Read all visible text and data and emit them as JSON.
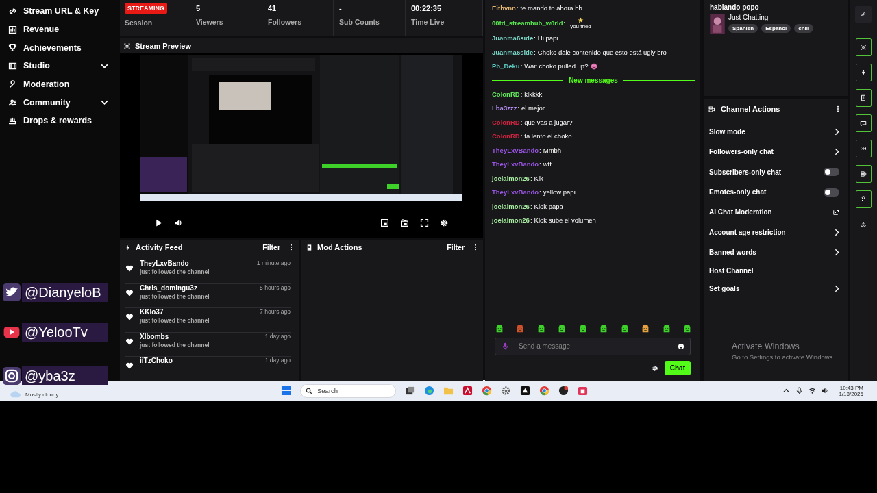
{
  "sidebar": {
    "items": [
      {
        "label": "Stream URL & Key",
        "has_submenu": false
      },
      {
        "label": "Revenue",
        "has_submenu": false
      },
      {
        "label": "Achievements",
        "has_submenu": false
      },
      {
        "label": "Studio",
        "has_submenu": true
      },
      {
        "label": "Moderation",
        "has_submenu": false
      },
      {
        "label": "Community",
        "has_submenu": true
      },
      {
        "label": "Drops & rewards",
        "has_submenu": false
      }
    ]
  },
  "session": {
    "badge": "STREAMING",
    "label": "Session"
  },
  "stats": [
    {
      "value": "5",
      "label": "Viewers"
    },
    {
      "value": "41",
      "label": "Followers"
    },
    {
      "value": "-",
      "label": "Sub Counts"
    },
    {
      "value": "00:22:35",
      "label": "Time Live"
    }
  ],
  "preview": {
    "title": "Stream Preview"
  },
  "activity_feed": {
    "title": "Activity Feed",
    "filter": "Filter",
    "items": [
      {
        "user": "TheyLxvBando",
        "action": "just followed the channel",
        "time": "1 minute ago"
      },
      {
        "user": "Chris_domingu3z",
        "action": "just followed the channel",
        "time": "5 hours ago"
      },
      {
        "user": "KKlo37",
        "action": "just followed the channel",
        "time": "7 hours ago"
      },
      {
        "user": "Xlbombs",
        "action": "just followed the channel",
        "time": "1 day ago"
      },
      {
        "user": "iiTzChoko",
        "time": "1 day ago"
      }
    ]
  },
  "mod_actions": {
    "title": "Mod Actions",
    "filter": "Filter"
  },
  "chat": {
    "name_separator": ":",
    "messages": [
      {
        "kind": "message",
        "user": "Eithvnn",
        "color": "#e8b872",
        "text": "te mando to ahora bb"
      },
      {
        "kind": "message",
        "user": "00fd_streamhub_w0rld",
        "color": "#59e34f",
        "emote_caption": "you tried"
      },
      {
        "kind": "message",
        "user": "Juanma6side",
        "color": "#7ad8c8",
        "text": "Hi papi"
      },
      {
        "kind": "message",
        "user": "Juanma6side",
        "color": "#7ad8c8",
        "text": "Choko dale contenido que esto está ugly bro"
      },
      {
        "kind": "message",
        "user": "Pb_Deku",
        "color": "#5ccac0",
        "text": "Wait choko pulled up?",
        "emoji": true
      },
      {
        "kind": "divider",
        "text": "New messages"
      },
      {
        "kind": "message",
        "user": "ColonRD",
        "color": "#62e85a",
        "text": "klkkkk"
      },
      {
        "kind": "message",
        "user": "Lba3zzz",
        "color": "#b58cf2",
        "text": "el mejor"
      },
      {
        "kind": "message",
        "user": "ColonRD",
        "color": "#d0243e",
        "text": "que vas a jugar?"
      },
      {
        "kind": "message",
        "user": "ColonRD",
        "color": "#d0243e",
        "text": "ta lento el choko"
      },
      {
        "kind": "message",
        "user": "TheyLxvBando",
        "color": "#9a55e6",
        "text": "Mmbh"
      },
      {
        "kind": "message",
        "user": "TheyLxvBando",
        "color": "#9a55e6",
        "text": "wtf"
      },
      {
        "kind": "message",
        "user": "joelalmon26",
        "color": "#a9f0a2",
        "text": "Klk"
      },
      {
        "kind": "message",
        "user": "TheyLxvBando",
        "color": "#9a55e6",
        "text": "yellow papi"
      },
      {
        "kind": "message",
        "user": "joelalmon26",
        "color": "#a9f0a2",
        "text": "Klok papa"
      },
      {
        "kind": "message",
        "user": "joelalmon26",
        "color": "#a9f0a2",
        "text": "Klok sube el volumen"
      }
    ],
    "input": {
      "placeholder": "Send a message"
    },
    "send_button": "Chat"
  },
  "stream_info": {
    "title": "hablando popo",
    "category": "Just Chatting",
    "tags": [
      "Spanish",
      "Español",
      "chill"
    ]
  },
  "channel_actions": {
    "title": "Channel Actions",
    "items": [
      {
        "label": "Slow mode",
        "kind": "submenu"
      },
      {
        "label": "Followers-only chat",
        "kind": "submenu"
      },
      {
        "label": "Subscribers-only chat",
        "kind": "toggle",
        "on": false
      },
      {
        "label": "Emotes-only chat",
        "kind": "toggle",
        "on": false
      },
      {
        "label": "AI Chat Moderation",
        "kind": "external"
      },
      {
        "label": "Account age restriction",
        "kind": "submenu"
      },
      {
        "label": "Banned words",
        "kind": "submenu"
      },
      {
        "label": "Host Channel",
        "kind": "plain"
      },
      {
        "label": "Set goals",
        "kind": "submenu"
      }
    ]
  },
  "os_notice": {
    "title": "Activate Windows",
    "text": "Go to Settings to activate Windows."
  },
  "overlays": [
    {
      "kind": "twitter",
      "handle": "@DianyeloB"
    },
    {
      "kind": "youtube",
      "handle": "@YelooTv"
    },
    {
      "kind": "instagram",
      "handle": "@yba3z"
    }
  ],
  "taskbar": {
    "weather": "Mostly cloudy",
    "search": {
      "placeholder": "Search"
    },
    "time": "10:43 PM",
    "date": "1/13/2026"
  }
}
